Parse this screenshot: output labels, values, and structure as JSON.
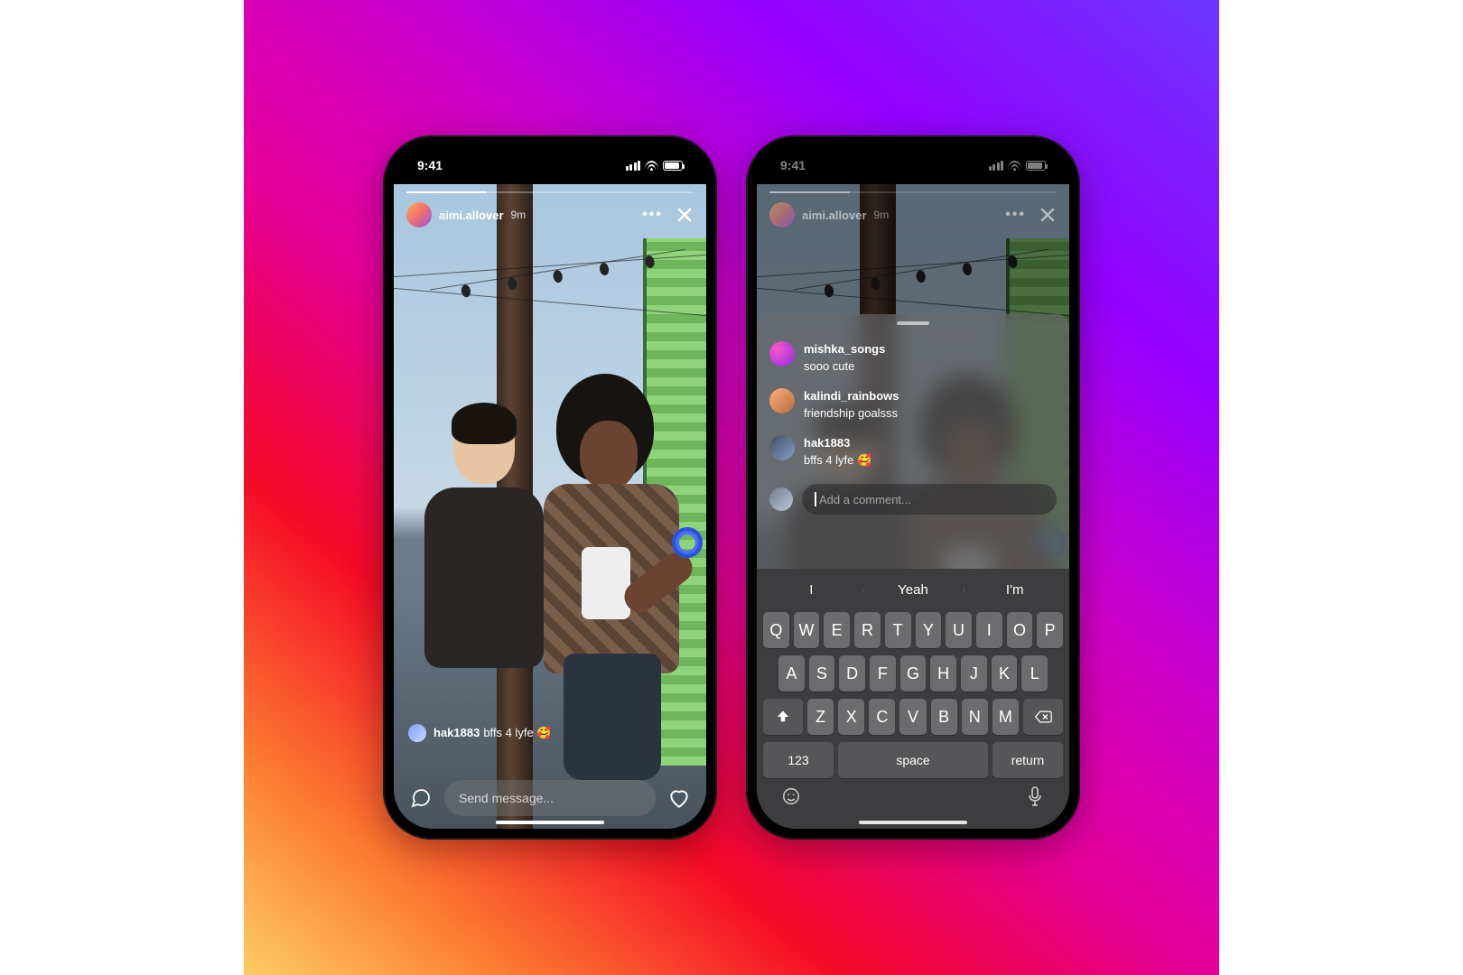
{
  "status": {
    "time": "9:41"
  },
  "story": {
    "username": "aimi.allover",
    "timestamp": "9m"
  },
  "phone1": {
    "floating_comment": {
      "username": "hak1883",
      "text": "bffs 4 lyfe 🥰"
    },
    "message_placeholder": "Send message..."
  },
  "sheet": {
    "comments": [
      {
        "username": "mishka_songs",
        "text": "sooo cute"
      },
      {
        "username": "kalindi_rainbows",
        "text": "friendship goalsss"
      },
      {
        "username": "hak1883",
        "text": "bffs 4 lyfe 🥰"
      }
    ],
    "compose_placeholder": "Add a comment..."
  },
  "keyboard": {
    "suggestions": [
      "I",
      "Yeah",
      "I'm"
    ],
    "row1": [
      "Q",
      "W",
      "E",
      "R",
      "T",
      "Y",
      "U",
      "I",
      "O",
      "P"
    ],
    "row2": [
      "A",
      "S",
      "D",
      "F",
      "G",
      "H",
      "J",
      "K",
      "L"
    ],
    "row3": [
      "Z",
      "X",
      "C",
      "V",
      "B",
      "N",
      "M"
    ],
    "numbers_label": "123",
    "space_label": "space",
    "return_label": "return"
  }
}
